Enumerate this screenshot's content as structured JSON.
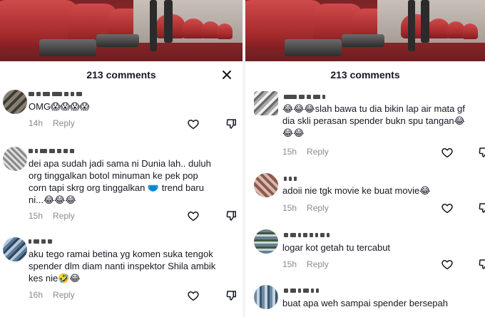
{
  "comments_count_label": "213 comments",
  "left_panel": {
    "comments": [
      {
        "text": "OMG😱😱😱😱",
        "time": "14h",
        "reply_label": "Reply"
      },
      {
        "text": "dei apa sudah jadi sama ni Dunia lah.. duluh\norg tinggalkan botol minuman ke pek pop\ncorn tapi skrg org tinggalkan 🩲 trend baru\nni...😂😂😂",
        "time": "15h",
        "reply_label": "Reply"
      },
      {
        "text": "aku tego ramai betina yg komen suka tengok\nspender dlm diam nanti inspektor Shila ambik\nkes nie🤣😂",
        "time": "16h",
        "reply_label": "Reply"
      }
    ]
  },
  "right_panel": {
    "comments": [
      {
        "text": "😂😂😂slah bawa tu dia bikin lap air mata gf\ndia skli perasan spender bukn spu tangan😂\n😂😂",
        "time": "15h",
        "reply_label": "Reply"
      },
      {
        "text": "adoii nie tgk movie ke buat movie😂",
        "time": "15h",
        "reply_label": "Reply"
      },
      {
        "text": "logar kot getah tu tercabut",
        "time": "15h",
        "reply_label": "Reply"
      },
      {
        "text": "buat apa weh sampai spender bersepah",
        "time": "",
        "reply_label": ""
      }
    ]
  },
  "icons": {
    "close": "close-icon",
    "like": "heart-outline-icon",
    "dislike": "thumbs-down-outline-icon"
  },
  "colors": {
    "text_primary": "#161823",
    "text_secondary": "#8a8b91",
    "seat_red": "#b13234"
  }
}
